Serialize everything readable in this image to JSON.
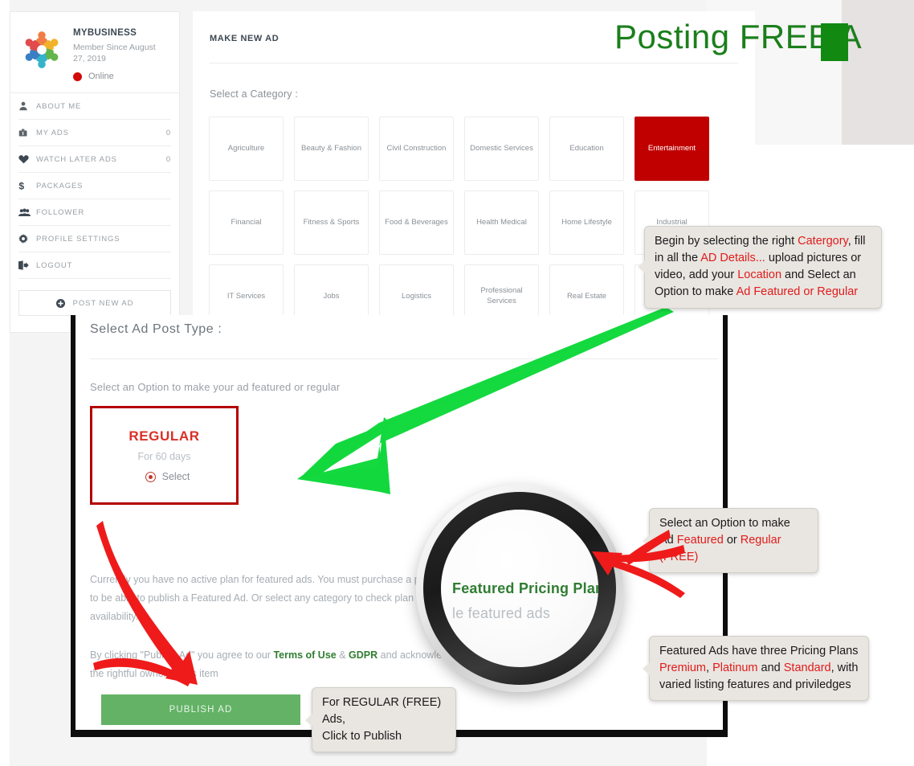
{
  "headline": {
    "text": "Posting FREE A",
    "color": "#1b7f1b"
  },
  "sidebar": {
    "business_name": "MYBUSINESS",
    "member_since": "Member Since August 27, 2019",
    "status": "Online",
    "status_color": "#d10a0a",
    "items": [
      {
        "label": "ABOUT ME",
        "icon": "person-icon",
        "count": ""
      },
      {
        "label": "MY ADS",
        "icon": "briefcase-icon",
        "count": "0"
      },
      {
        "label": "WATCH LATER ADS",
        "icon": "heart-icon",
        "count": "0"
      },
      {
        "label": "PACKAGES",
        "icon": "dollar-icon",
        "count": ""
      },
      {
        "label": "FOLLOWER",
        "icon": "people-icon",
        "count": ""
      },
      {
        "label": "PROFILE SETTINGS",
        "icon": "gear-icon",
        "count": ""
      },
      {
        "label": "LOGOUT",
        "icon": "logout-icon",
        "count": ""
      }
    ],
    "post_new_ad": "POST NEW AD"
  },
  "main": {
    "title": "MAKE NEW AD",
    "category_label": "Select a Category :",
    "selected_category": "Entertainment",
    "selected_color": "#c00000",
    "categories": [
      [
        "Agriculture",
        "Beauty & Fashion",
        "Civil Construction",
        "Domestic Services",
        "Education",
        "Entertainment"
      ],
      [
        "Financial",
        "Fitness & Sports",
        "Food & Beverages",
        "Health Medical",
        "Home Lifestyle",
        "Industrial"
      ],
      [
        "IT Services",
        "Jobs",
        "Logistics",
        "Professional Services",
        "Real Estate",
        ""
      ]
    ]
  },
  "ad_post_type": {
    "title": "Select Ad Post Type :",
    "subtitle": "Select an Option to make your ad featured or regular",
    "regular_card": {
      "name": "REGULAR",
      "duration": "For 60 days",
      "select_label": "Select"
    },
    "notice_line1": "Currently you have no active plan for featured ads. You must purchase a plan",
    "notice_line2": "to be able to publish a Featured Ad. Or select any category to check plan",
    "notice_line3": "availability.",
    "terms_prefix": "By clicking \"Publish Ad\" you agree to our ",
    "terms_link1": "Terms of Use",
    "terms_amp": " & ",
    "terms_link2": "GDPR",
    "terms_suffix": " and acknowledge that you are",
    "terms_line2": "the rightful owner of this item",
    "publish_button": "PUBLISH AD",
    "publish_color": "#63b265"
  },
  "loupe": {
    "line1": "Featured Pricing Plan",
    "line2": "le featured ads"
  },
  "callouts": {
    "c1": {
      "p1a": "Begin by selecting the right ",
      "p1b": "Catergory",
      "p1c": ", fill",
      "p2a": "in all the ",
      "p2b": "AD Details...",
      "p2c": " upload pictures or",
      "p3a": "video, add your ",
      "p3b": "Location",
      "p3c": " and Select an",
      "p4a": "Option to make ",
      "p4b": "Ad Featured or Regular"
    },
    "c2": {
      "p1": "Select an Option to make",
      "p2a": "Ad ",
      "p2b": "Featured",
      "p2c": " or ",
      "p2d": "Regular (FREE)"
    },
    "c3": {
      "p1": "Featured Ads have three Pricing Plans",
      "p2a": "Premium",
      "p2b": ", ",
      "p2c": "Platinum",
      "p2d": " and ",
      "p2e": "Standard",
      "p2f": ", with",
      "p3": "varied listing features and priviledges"
    },
    "c4": {
      "p1": "For REGULAR (FREE) Ads,",
      "p2": "Click to Publish"
    }
  }
}
